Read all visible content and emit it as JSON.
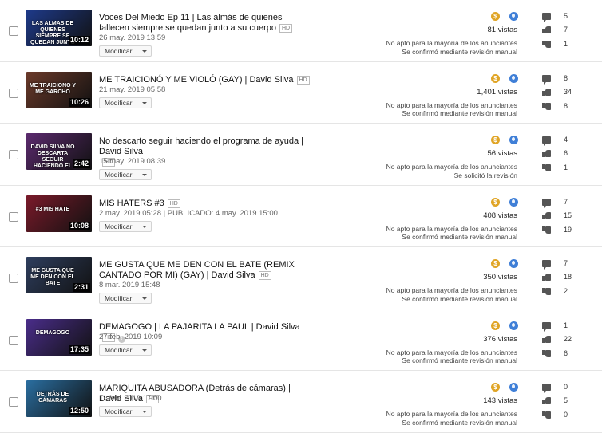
{
  "videos": [
    {
      "title": "Voces Del Miedo Ep 11 | Las almás de quienes fallecen siempre se quedan junto a su cuerpo",
      "hd": "HD",
      "date": "26 may. 2019 13:59",
      "edit_label": "Modificar",
      "thumbnail": {
        "caption": "LAS ALMAS DE QUIENES SIEMPRE SE QUEDAN JUNTO",
        "duration": "10:12",
        "color": "#1e3a8a"
      },
      "monetization_icon": "dollar-coin-icon",
      "visibility_icon": "globe-icon",
      "views": "81 vistas",
      "monetization": [
        "No apto para la mayoría de los anunciantes",
        "Se confirmó mediante revisión manual"
      ],
      "comments": "5",
      "likes": "7",
      "dislikes": "1"
    },
    {
      "title": "ME TRAICIONÓ Y ME VIOLÓ (GAY) | David Silva",
      "hd": "HD",
      "date": "21 may. 2019 05:58",
      "edit_label": "Modificar",
      "thumbnail": {
        "caption": "ME TRAICIONO Y ME GARCHO",
        "duration": "10:26",
        "color": "#6b3a2a"
      },
      "monetization_icon": "dollar-coin-icon",
      "visibility_icon": "globe-icon",
      "views": "1,401 vistas",
      "monetization": [
        "No apto para la mayoría de los anunciantes",
        "Se confirmó mediante revisión manual"
      ],
      "comments": "8",
      "likes": "34",
      "dislikes": "8"
    },
    {
      "title": "No descarto seguir haciendo el programa de ayuda | David Silva",
      "hd": "HD",
      "date": "15 may. 2019 08:39",
      "edit_label": "Modificar",
      "thumbnail": {
        "caption": "DAVID SILVA NO DESCARTA SEGUIR HACIENDO EL PROGRAMA DE AYUDA",
        "duration": "2:42",
        "color": "#5b2a6e"
      },
      "monetization_icon": "dollar-coin-icon",
      "visibility_icon": "globe-icon",
      "views": "56 vistas",
      "monetization": [
        "No apto para la mayoría de los anunciantes",
        "Se solicitó la revisión"
      ],
      "comments": "4",
      "likes": "6",
      "dislikes": "1"
    },
    {
      "title": "MIS HATERS #3",
      "hd": "HD",
      "date": "2 may. 2019 05:28 | PUBLICADO: 4 may. 2019 15:00",
      "edit_label": "Modificar",
      "thumbnail": {
        "caption": "#3 MIS HATE",
        "duration": "10:08",
        "color": "#7a1a2a"
      },
      "monetization_icon": "dollar-coin-icon",
      "visibility_icon": "globe-icon",
      "views": "408 vistas",
      "monetization": [
        "No apto para la mayoría de los anunciantes",
        "Se confirmó mediante revisión manual"
      ],
      "comments": "7",
      "likes": "15",
      "dislikes": "19"
    },
    {
      "title": "ME GUSTA QUE ME DEN CON EL BATE (REMIX CANTADO POR MI) (GAY) | David Silva",
      "hd": "HD",
      "date": "8 mar. 2019 15:48",
      "edit_label": "Modificar",
      "thumbnail": {
        "caption": "ME GUSTA QUE ME DEN CON EL BATE",
        "duration": "2:31",
        "color": "#2e3e5e"
      },
      "monetization_icon": "dollar-coin-icon",
      "visibility_icon": "globe-icon",
      "views": "350 vistas",
      "monetization": [
        "No apto para la mayoría de los anunciantes",
        "Se confirmó mediante revisión manual"
      ],
      "comments": "7",
      "likes": "18",
      "dislikes": "2"
    },
    {
      "title": "DEMAGOGO | LA PAJARITA LA PAUL | David Silva",
      "hd": "HD",
      "date": "27 feb. 2019 10:09",
      "edit_label": "Modificar",
      "thumbnail": {
        "caption": "DEMAGOGO",
        "duration": "17:35",
        "color": "#4a2d8a"
      },
      "monetization_icon": "dollar-coin-icon",
      "visibility_icon": "globe-icon",
      "views": "376 vistas",
      "monetization": [
        "No apto para la mayoría de los anunciantes",
        "Se confirmó mediante revisión manual"
      ],
      "comments": "1",
      "likes": "22",
      "dislikes": "6"
    },
    {
      "title": "MARIQUITA ABUSADORA (Detrás de cámaras) | David Silva",
      "hd": "HD",
      "date": "11 feb. 2019 17:00",
      "edit_label": "Modificar",
      "thumbnail": {
        "caption": "DETRÁS DE CÁMARAS",
        "duration": "12:50",
        "color": "#2a6ea0"
      },
      "monetization_icon": "dollar-coin-icon",
      "visibility_icon": "globe-icon",
      "views": "143 vistas",
      "monetization": [
        "No apto para la mayoría de los anunciantes",
        "Se confirmó mediante revisión manual"
      ],
      "comments": "0",
      "likes": "5",
      "dislikes": "0"
    }
  ],
  "colors": {
    "coin": "#e0a526",
    "globe": "#3f7fd7",
    "divider": "#e5e5e5"
  }
}
